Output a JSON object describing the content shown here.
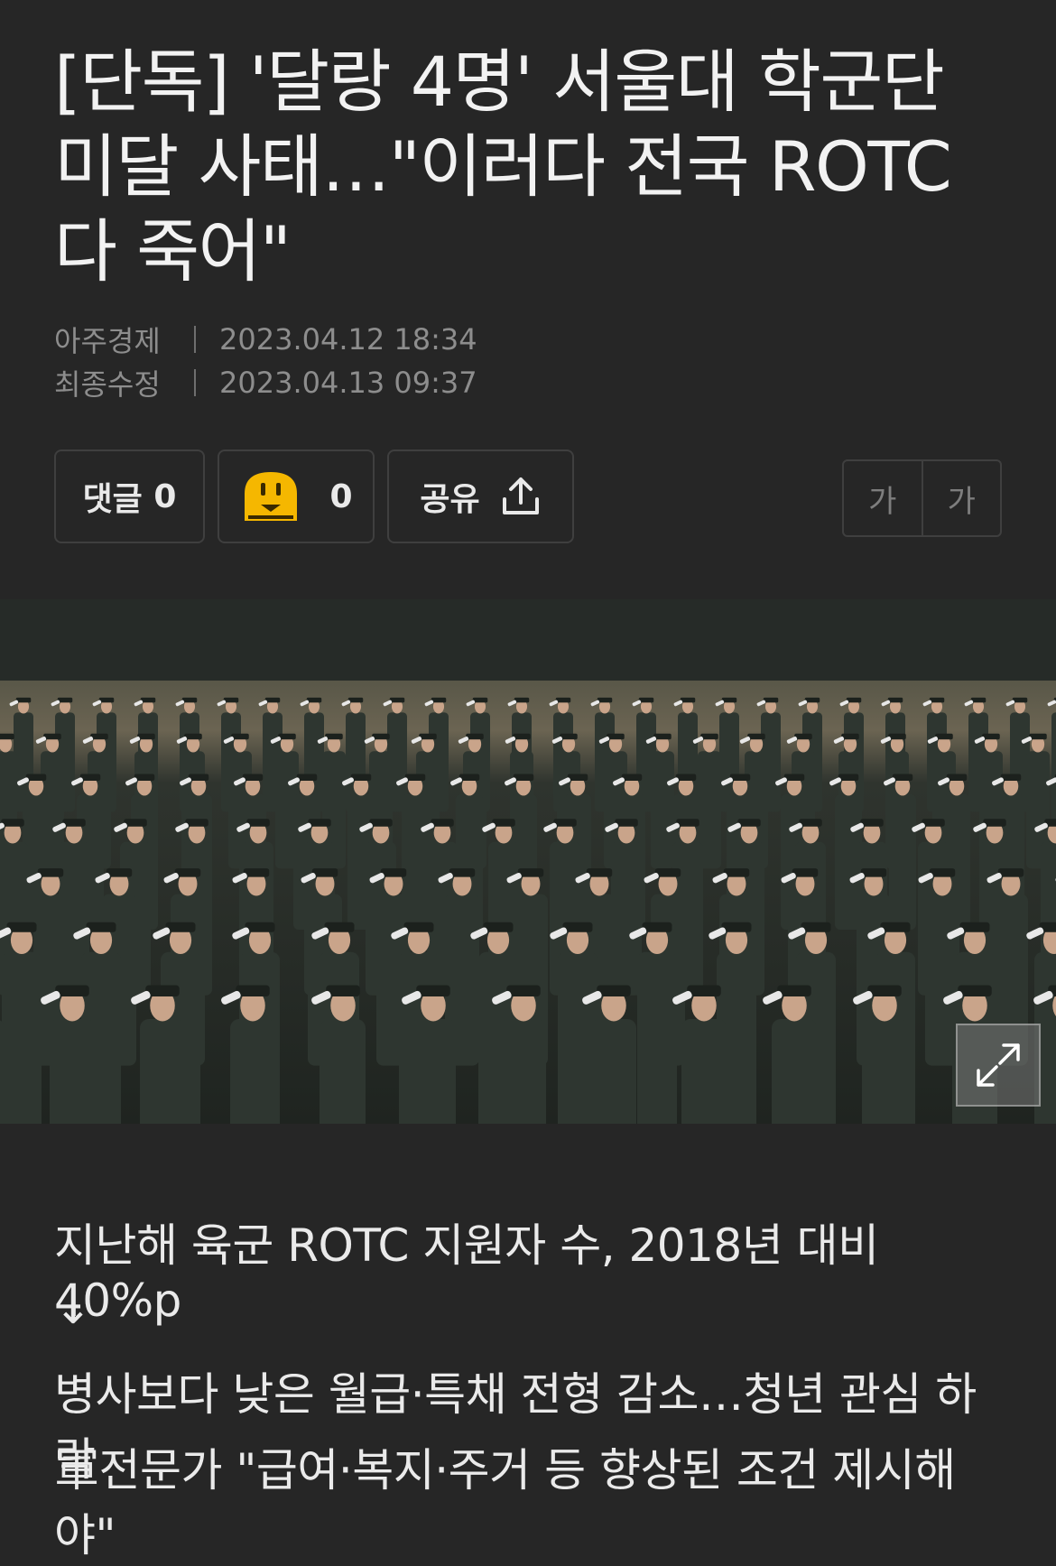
{
  "article": {
    "title": "[단독] '달랑 4명' 서울대 학군단 미달 사태…\"이러다 전국 ROTC 다 죽어\"",
    "publisher": "아주경제",
    "published_at": "2023.04.12 18:34",
    "modified_label": "최종수정",
    "modified_at": "2023.04.13 09:37"
  },
  "actions": {
    "comment_label": "댓글",
    "comment_count": "0",
    "reaction_count": "0",
    "share_label": "공유",
    "font_small": "가",
    "font_large": "가"
  },
  "summary": {
    "line1": "지난해 육군 ROTC 지원자 수, 2018년 대비 40%p",
    "line1_cont": "↓",
    "line2": "병사보다 낮은 월급·특채 전형 감소…청년 관심 하락",
    "line3": "軍전문가 \"급여·복지·주거 등 향상된 조건 제시해야\""
  },
  "icons": {
    "reaction": "plug-face-icon",
    "share": "share-upload-icon",
    "expand": "expand-icon"
  },
  "colors": {
    "background": "#262626",
    "reaction_yellow": "#f5b700"
  }
}
